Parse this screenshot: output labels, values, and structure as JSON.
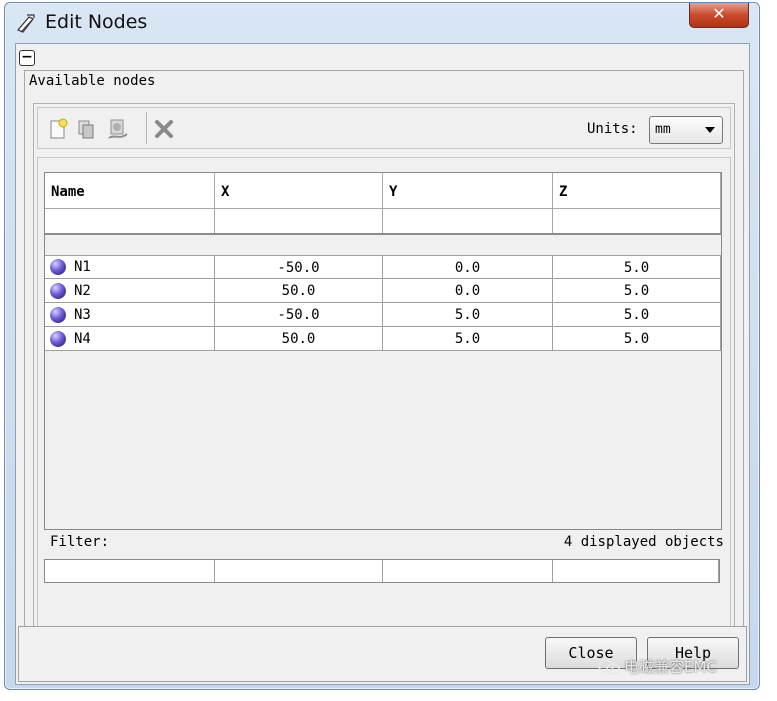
{
  "window": {
    "title": "Edit Nodes",
    "close_glyph": "✕"
  },
  "group": {
    "title": "Available nodes"
  },
  "toolbar": {
    "icons": [
      "new-node-icon",
      "copy-node-icon",
      "reorder-node-icon",
      "delete-node-icon"
    ],
    "units_label": "Units:",
    "units_value": "mm"
  },
  "table": {
    "columns": [
      "Name",
      "X",
      "Y",
      "Z"
    ],
    "rows": [
      {
        "name": "N1",
        "x": "-50.0",
        "y": "0.0",
        "z": "5.0"
      },
      {
        "name": "N2",
        "x": "50.0",
        "y": "0.0",
        "z": "5.0"
      },
      {
        "name": "N3",
        "x": "-50.0",
        "y": "5.0",
        "z": "5.0"
      },
      {
        "name": "N4",
        "x": "50.0",
        "y": "5.0",
        "z": "5.0"
      }
    ]
  },
  "footer": {
    "filter_label": "Filter:",
    "displayed_count": "4 displayed objects"
  },
  "buttons": {
    "close": "Close",
    "help": "Help"
  },
  "watermark": {
    "text": "电磁兼容EMC"
  },
  "colors": {
    "delete_icon": "#8a8a8a",
    "node_icon": "#5a4bc8",
    "close_button": "#c94a2c"
  }
}
